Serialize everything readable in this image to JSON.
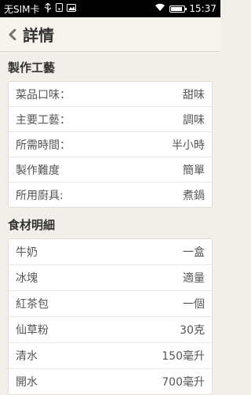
{
  "status_bar": {
    "carrier": "无SIM卡",
    "time": "15:37",
    "battery_level": 0.85
  },
  "header": {
    "title": "詳情"
  },
  "sections": {
    "craft": {
      "title": "製作工藝",
      "rows": [
        {
          "label": "菜品口味：",
          "value": "甜味"
        },
        {
          "label": "主要工藝：",
          "value": "調味"
        },
        {
          "label": "所需時間：",
          "value": "半小時"
        },
        {
          "label": "製作難度",
          "value": "簡單"
        },
        {
          "label": "所用廚具:",
          "value": "煮鍋"
        }
      ]
    },
    "ingredients": {
      "title": "食材明細",
      "rows": [
        {
          "label": "牛奶",
          "value": "一盒"
        },
        {
          "label": "冰塊",
          "value": "適量"
        },
        {
          "label": "紅茶包",
          "value": "一個"
        },
        {
          "label": "仙草粉",
          "value": "30克"
        },
        {
          "label": "清水",
          "value": "150毫升"
        },
        {
          "label": "開水",
          "value": "700毫升"
        }
      ]
    }
  }
}
